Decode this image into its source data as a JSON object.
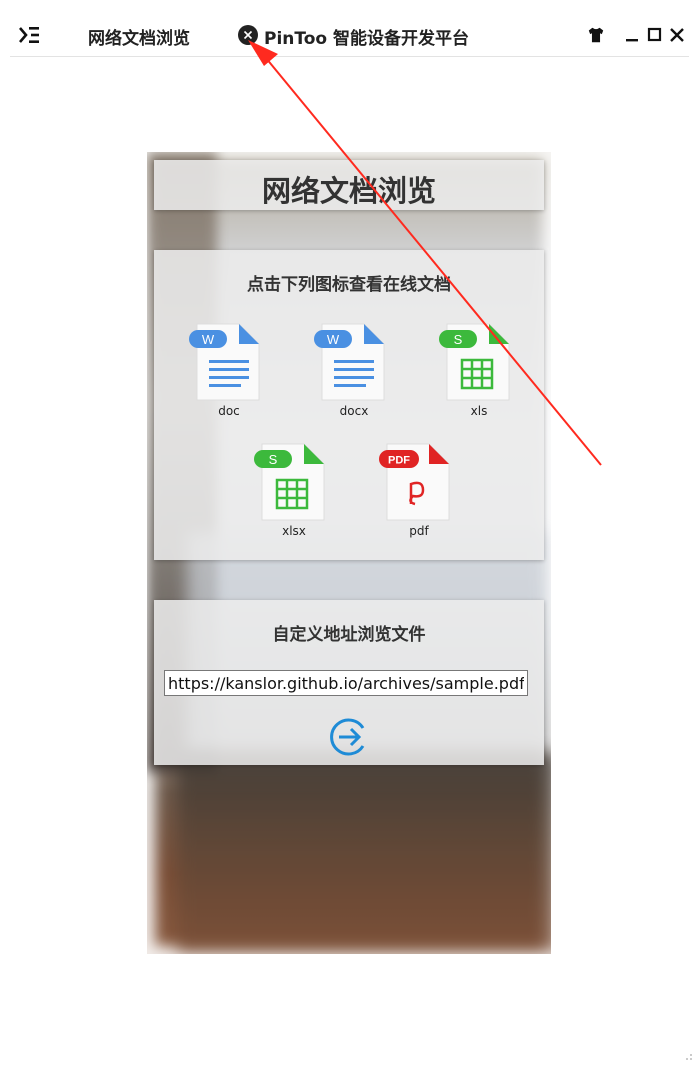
{
  "titlebar": {
    "tab_title": "网络文档浏览",
    "app_title": "PinToo 智能设备开发平台"
  },
  "page": {
    "heading": "网络文档浏览",
    "files_prompt": "点击下列图标查看在线文档",
    "files": [
      {
        "label": "doc",
        "badge": "W",
        "kind": "word",
        "color": "#4a90e2"
      },
      {
        "label": "docx",
        "badge": "W",
        "kind": "word",
        "color": "#4a90e2"
      },
      {
        "label": "xls",
        "badge": "S",
        "kind": "sheet",
        "color": "#3cb93c"
      },
      {
        "label": "xlsx",
        "badge": "S",
        "kind": "sheet",
        "color": "#3cb93c"
      },
      {
        "label": "pdf",
        "badge": "PDF",
        "kind": "pdf",
        "color": "#e02424"
      }
    ],
    "custom_url_title": "自定义地址浏览文件",
    "url_value": "https://kanslor.github.io/archives/sample.pdf"
  },
  "colors": {
    "accent_blue": "#1e8bd6",
    "annotation_red": "#ff2a1f"
  },
  "icons": [
    "menu-icon",
    "close-icon",
    "shirt-icon",
    "minimize-icon",
    "maximize-icon",
    "window-close-icon",
    "arrow-right-circle-icon"
  ]
}
